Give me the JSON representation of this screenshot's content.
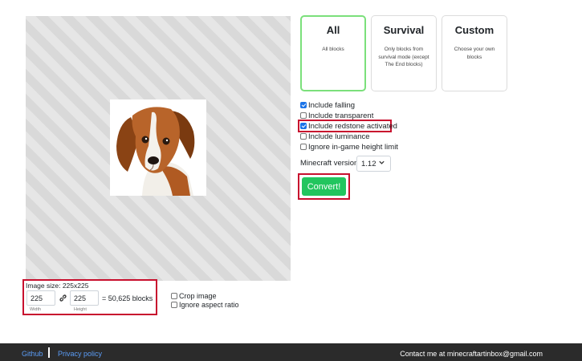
{
  "modes": [
    {
      "title": "All",
      "desc": "All blocks",
      "active": true
    },
    {
      "title": "Survival",
      "desc": "Only blocks from survival mode (except The End blocks)",
      "active": false
    },
    {
      "title": "Custom",
      "desc": "Choose your own blocks",
      "active": false
    }
  ],
  "options": [
    {
      "label": "Include falling",
      "checked": true
    },
    {
      "label": "Include transparent",
      "checked": false
    },
    {
      "label": "Include redstone activated",
      "checked": true
    },
    {
      "label": "Include luminance",
      "checked": false
    },
    {
      "label": "Ignore in-game height limit",
      "checked": false
    }
  ],
  "version": {
    "label": "Minecraft version:",
    "value": "1.12"
  },
  "convert_label": "Convert!",
  "size": {
    "label": "Image size: 225x225",
    "width": "225",
    "height": "225",
    "width_label": "Width",
    "height_label": "Height",
    "blocks": "= 50,625 blocks"
  },
  "image_options": [
    {
      "label": "Crop image",
      "checked": false
    },
    {
      "label": "Ignore aspect ratio",
      "checked": false
    }
  ],
  "footer": {
    "github": "Github",
    "privacy": "Privacy policy",
    "contact": "Contact me at minecraftartinbox@gmail.com"
  },
  "colors": {
    "accent": "#22c55e",
    "highlight": "#c8102e",
    "footer_bg": "#2b2b2b",
    "link": "#5b9cf5"
  },
  "icons": {
    "link": "link-icon",
    "chevron": "chevron-down-icon"
  }
}
